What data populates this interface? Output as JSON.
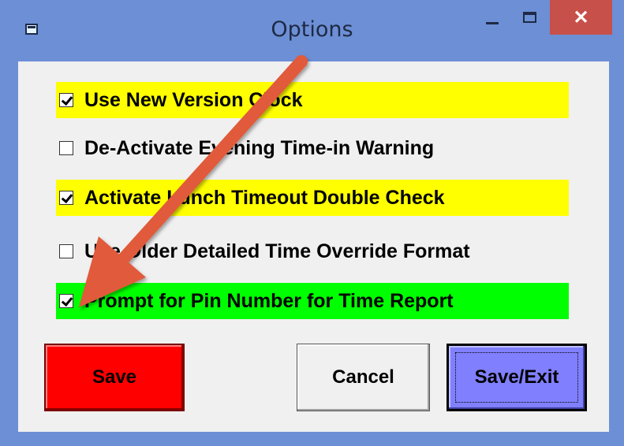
{
  "window": {
    "title": "Options",
    "close_glyph": "✕"
  },
  "options": [
    {
      "label": "Use New Version Clock",
      "checked": true,
      "highlight": "#ffff00"
    },
    {
      "label": "De-Activate Evening Time-in Warning",
      "checked": false,
      "highlight": ""
    },
    {
      "label": "Activate Lunch Timeout Double Check",
      "checked": true,
      "highlight": "#ffff00"
    },
    {
      "label": "Use Older Detailed Time Override Format",
      "checked": false,
      "highlight": ""
    },
    {
      "label": "Prompt for Pin Number for Time Report",
      "checked": true,
      "highlight": "#00ff00"
    }
  ],
  "buttons": {
    "save_label": "Save",
    "cancel_label": "Cancel",
    "save_exit_label": "Save/Exit"
  },
  "colors": {
    "window_frame": "#6d8fd6",
    "close_button": "#c7504a",
    "save_button": "#ff0000",
    "save_exit_button": "#8080ff",
    "annotation_arrow": "#e05a3a"
  },
  "icons": {
    "app": "window-icon",
    "minimize": "minimize-icon",
    "maximize": "maximize-icon",
    "close": "close-icon",
    "annotation": "arrow-annotation"
  }
}
